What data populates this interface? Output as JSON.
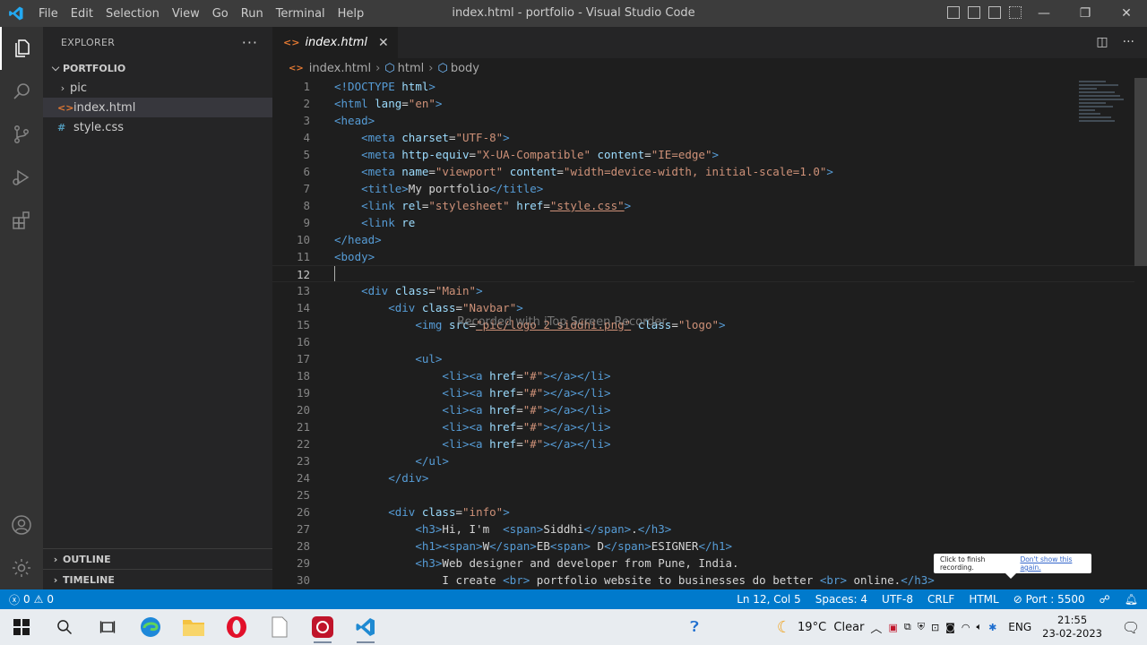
{
  "titlebar": {
    "menu": [
      "File",
      "Edit",
      "Selection",
      "View",
      "Go",
      "Run",
      "Terminal",
      "Help"
    ],
    "window_title": "index.html - portfolio - Visual Studio Code"
  },
  "sidebar": {
    "title": "EXPLORER",
    "folder": "PORTFOLIO",
    "items": [
      {
        "name": "pic",
        "type": "folder"
      },
      {
        "name": "index.html",
        "type": "html"
      },
      {
        "name": "style.css",
        "type": "css"
      }
    ],
    "outline": "OUTLINE",
    "timeline": "TIMELINE"
  },
  "editor": {
    "tab_label": "index.html",
    "breadcrumb": [
      "index.html",
      "html",
      "body"
    ],
    "current_line": 12,
    "lines": [
      [
        [
          "tg",
          "<!DOCTYPE "
        ],
        [
          "at",
          "html"
        ],
        [
          "tg",
          ">"
        ]
      ],
      [
        [
          "tg",
          "<html "
        ],
        [
          "at",
          "lang"
        ],
        [
          "tx",
          "="
        ],
        [
          "st",
          "\"en\""
        ],
        [
          "tg",
          ">"
        ]
      ],
      [
        [
          "tg",
          "<head>"
        ]
      ],
      [
        [
          "tx",
          "    "
        ],
        [
          "tg",
          "<meta "
        ],
        [
          "at",
          "charset"
        ],
        [
          "tx",
          "="
        ],
        [
          "st",
          "\"UTF-8\""
        ],
        [
          "tg",
          ">"
        ]
      ],
      [
        [
          "tx",
          "    "
        ],
        [
          "tg",
          "<meta "
        ],
        [
          "at",
          "http-equiv"
        ],
        [
          "tx",
          "="
        ],
        [
          "st",
          "\"X-UA-Compatible\""
        ],
        [
          "tx",
          " "
        ],
        [
          "at",
          "content"
        ],
        [
          "tx",
          "="
        ],
        [
          "st",
          "\"IE=edge\""
        ],
        [
          "tg",
          ">"
        ]
      ],
      [
        [
          "tx",
          "    "
        ],
        [
          "tg",
          "<meta "
        ],
        [
          "at",
          "name"
        ],
        [
          "tx",
          "="
        ],
        [
          "st",
          "\"viewport\""
        ],
        [
          "tx",
          " "
        ],
        [
          "at",
          "content"
        ],
        [
          "tx",
          "="
        ],
        [
          "st",
          "\"width=device-width, initial-scale=1.0\""
        ],
        [
          "tg",
          ">"
        ]
      ],
      [
        [
          "tx",
          "    "
        ],
        [
          "tg",
          "<title>"
        ],
        [
          "tx",
          "My portfolio"
        ],
        [
          "tg",
          "</title>"
        ]
      ],
      [
        [
          "tx",
          "    "
        ],
        [
          "tg",
          "<link "
        ],
        [
          "at",
          "rel"
        ],
        [
          "tx",
          "="
        ],
        [
          "st",
          "\"stylesheet\""
        ],
        [
          "tx",
          " "
        ],
        [
          "at",
          "href"
        ],
        [
          "tx",
          "="
        ],
        [
          "stu",
          "\"style.css\""
        ],
        [
          "tg",
          ">"
        ]
      ],
      [
        [
          "tx",
          "    "
        ],
        [
          "tg",
          "<link "
        ],
        [
          "at",
          "re"
        ]
      ],
      [
        [
          "tg",
          "</head>"
        ]
      ],
      [
        [
          "tg",
          "<body>"
        ]
      ],
      [
        [
          "tx",
          ""
        ]
      ],
      [
        [
          "tx",
          "    "
        ],
        [
          "tg",
          "<div "
        ],
        [
          "at",
          "class"
        ],
        [
          "tx",
          "="
        ],
        [
          "st",
          "\"Main\""
        ],
        [
          "tg",
          ">"
        ]
      ],
      [
        [
          "tx",
          "        "
        ],
        [
          "tg",
          "<div "
        ],
        [
          "at",
          "class"
        ],
        [
          "tx",
          "="
        ],
        [
          "st",
          "\"Navbar\""
        ],
        [
          "tg",
          ">"
        ]
      ],
      [
        [
          "tx",
          "            "
        ],
        [
          "tg",
          "<img "
        ],
        [
          "at",
          "src"
        ],
        [
          "tx",
          "="
        ],
        [
          "stu",
          "\"pic/logo 2 siddhi.png\""
        ],
        [
          "tx",
          " "
        ],
        [
          "at",
          "class"
        ],
        [
          "tx",
          "="
        ],
        [
          "st",
          "\"logo\""
        ],
        [
          "tg",
          ">"
        ]
      ],
      [
        [
          "tx",
          ""
        ]
      ],
      [
        [
          "tx",
          "            "
        ],
        [
          "tg",
          "<ul>"
        ]
      ],
      [
        [
          "tx",
          "                "
        ],
        [
          "tg",
          "<li><a "
        ],
        [
          "at",
          "href"
        ],
        [
          "tx",
          "="
        ],
        [
          "st",
          "\"#\""
        ],
        [
          "tg",
          "></a></li>"
        ]
      ],
      [
        [
          "tx",
          "                "
        ],
        [
          "tg",
          "<li><a "
        ],
        [
          "at",
          "href"
        ],
        [
          "tx",
          "="
        ],
        [
          "st",
          "\"#\""
        ],
        [
          "tg",
          "></a></li>"
        ]
      ],
      [
        [
          "tx",
          "                "
        ],
        [
          "tg",
          "<li><a "
        ],
        [
          "at",
          "href"
        ],
        [
          "tx",
          "="
        ],
        [
          "st",
          "\"#\""
        ],
        [
          "tg",
          "></a></li>"
        ]
      ],
      [
        [
          "tx",
          "                "
        ],
        [
          "tg",
          "<li><a "
        ],
        [
          "at",
          "href"
        ],
        [
          "tx",
          "="
        ],
        [
          "st",
          "\"#\""
        ],
        [
          "tg",
          "></a></li>"
        ]
      ],
      [
        [
          "tx",
          "                "
        ],
        [
          "tg",
          "<li><a "
        ],
        [
          "at",
          "href"
        ],
        [
          "tx",
          "="
        ],
        [
          "st",
          "\"#\""
        ],
        [
          "tg",
          "></a></li>"
        ]
      ],
      [
        [
          "tx",
          "            "
        ],
        [
          "tg",
          "</ul>"
        ]
      ],
      [
        [
          "tx",
          "        "
        ],
        [
          "tg",
          "</div>"
        ]
      ],
      [
        [
          "tx",
          ""
        ]
      ],
      [
        [
          "tx",
          "        "
        ],
        [
          "tg",
          "<div "
        ],
        [
          "at",
          "class"
        ],
        [
          "tx",
          "="
        ],
        [
          "st",
          "\"info\""
        ],
        [
          "tg",
          ">"
        ]
      ],
      [
        [
          "tx",
          "            "
        ],
        [
          "tg",
          "<h3>"
        ],
        [
          "tx",
          "Hi, I'm  "
        ],
        [
          "tg",
          "<span>"
        ],
        [
          "tx",
          "Siddhi"
        ],
        [
          "tg",
          "</span>"
        ],
        [
          "tx",
          "."
        ],
        [
          "tg",
          "</h3>"
        ]
      ],
      [
        [
          "tx",
          "            "
        ],
        [
          "tg",
          "<h1><span>"
        ],
        [
          "tx",
          "W"
        ],
        [
          "tg",
          "</span>"
        ],
        [
          "tx",
          "EB"
        ],
        [
          "tg",
          "<span>"
        ],
        [
          "tx",
          " D"
        ],
        [
          "tg",
          "</span>"
        ],
        [
          "tx",
          "ESIGNER"
        ],
        [
          "tg",
          "</h1>"
        ]
      ],
      [
        [
          "tx",
          "            "
        ],
        [
          "tg",
          "<h3>"
        ],
        [
          "tx",
          "Web designer and developer from Pune, India."
        ]
      ],
      [
        [
          "tx",
          "                I create "
        ],
        [
          "tg",
          "<br>"
        ],
        [
          "tx",
          " portfolio website to businesses do better "
        ],
        [
          "tg",
          "<br>"
        ],
        [
          "tx",
          " online."
        ],
        [
          "tg",
          "</h3>"
        ]
      ]
    ]
  },
  "overlay": {
    "watermark": "Recorded with iTop Screen Recorder",
    "tooltip_text": "Click to finish recording.",
    "tooltip_link": "Don't show this again."
  },
  "statusbar": {
    "errors": "0",
    "warnings": "0",
    "position": "Ln 12, Col 5",
    "spaces": "Spaces: 4",
    "encoding": "UTF-8",
    "eol": "CRLF",
    "language": "HTML",
    "port": "Port : 5500"
  },
  "taskbar": {
    "weather": "19°C  Clear",
    "lang": "ENG",
    "time": "21:55",
    "date": "23-02-2023"
  },
  "colors": {
    "accent": "#007acc",
    "tag": "#569cd6",
    "attribute": "#9cdcfe",
    "string": "#ce9178"
  }
}
